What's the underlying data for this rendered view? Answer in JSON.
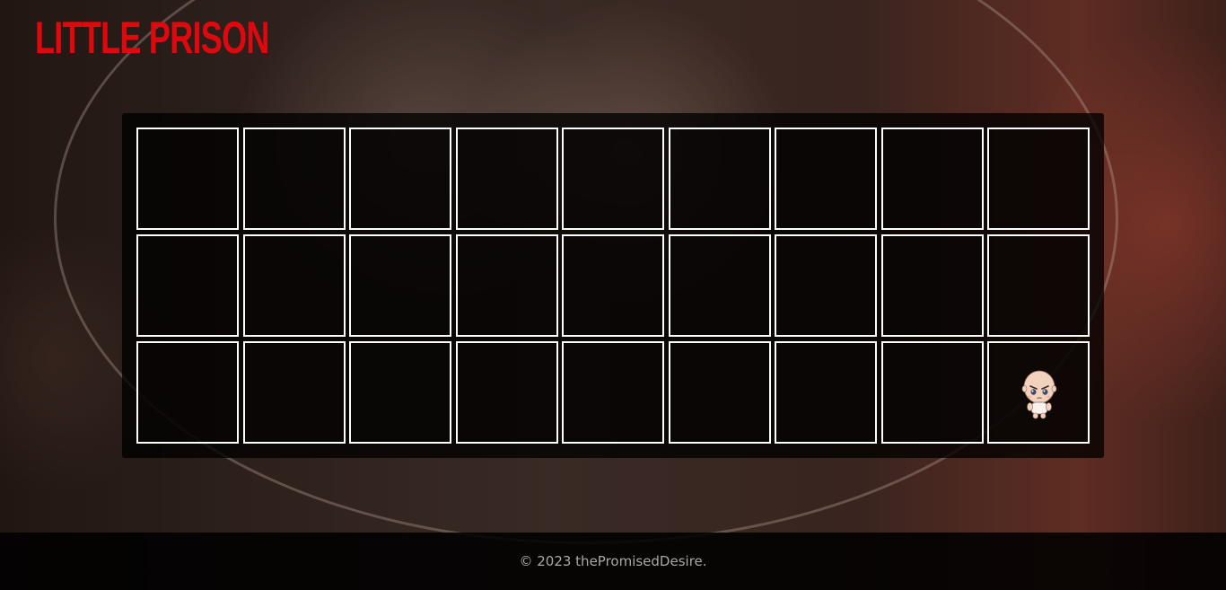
{
  "header": {
    "logo_text": "LITTLE PRISON"
  },
  "board": {
    "rows": 3,
    "columns": 9,
    "player_cell": {
      "row": 3,
      "column": 9
    },
    "player_icon": "chibi-baby-character-icon"
  },
  "footer": {
    "copyright": "© 2023 thePromisedDesire."
  },
  "colors": {
    "logo": "#e0080f",
    "cell_border": "#ffffff",
    "board_background": "#000000",
    "footer_text": "#a8a8a8"
  }
}
